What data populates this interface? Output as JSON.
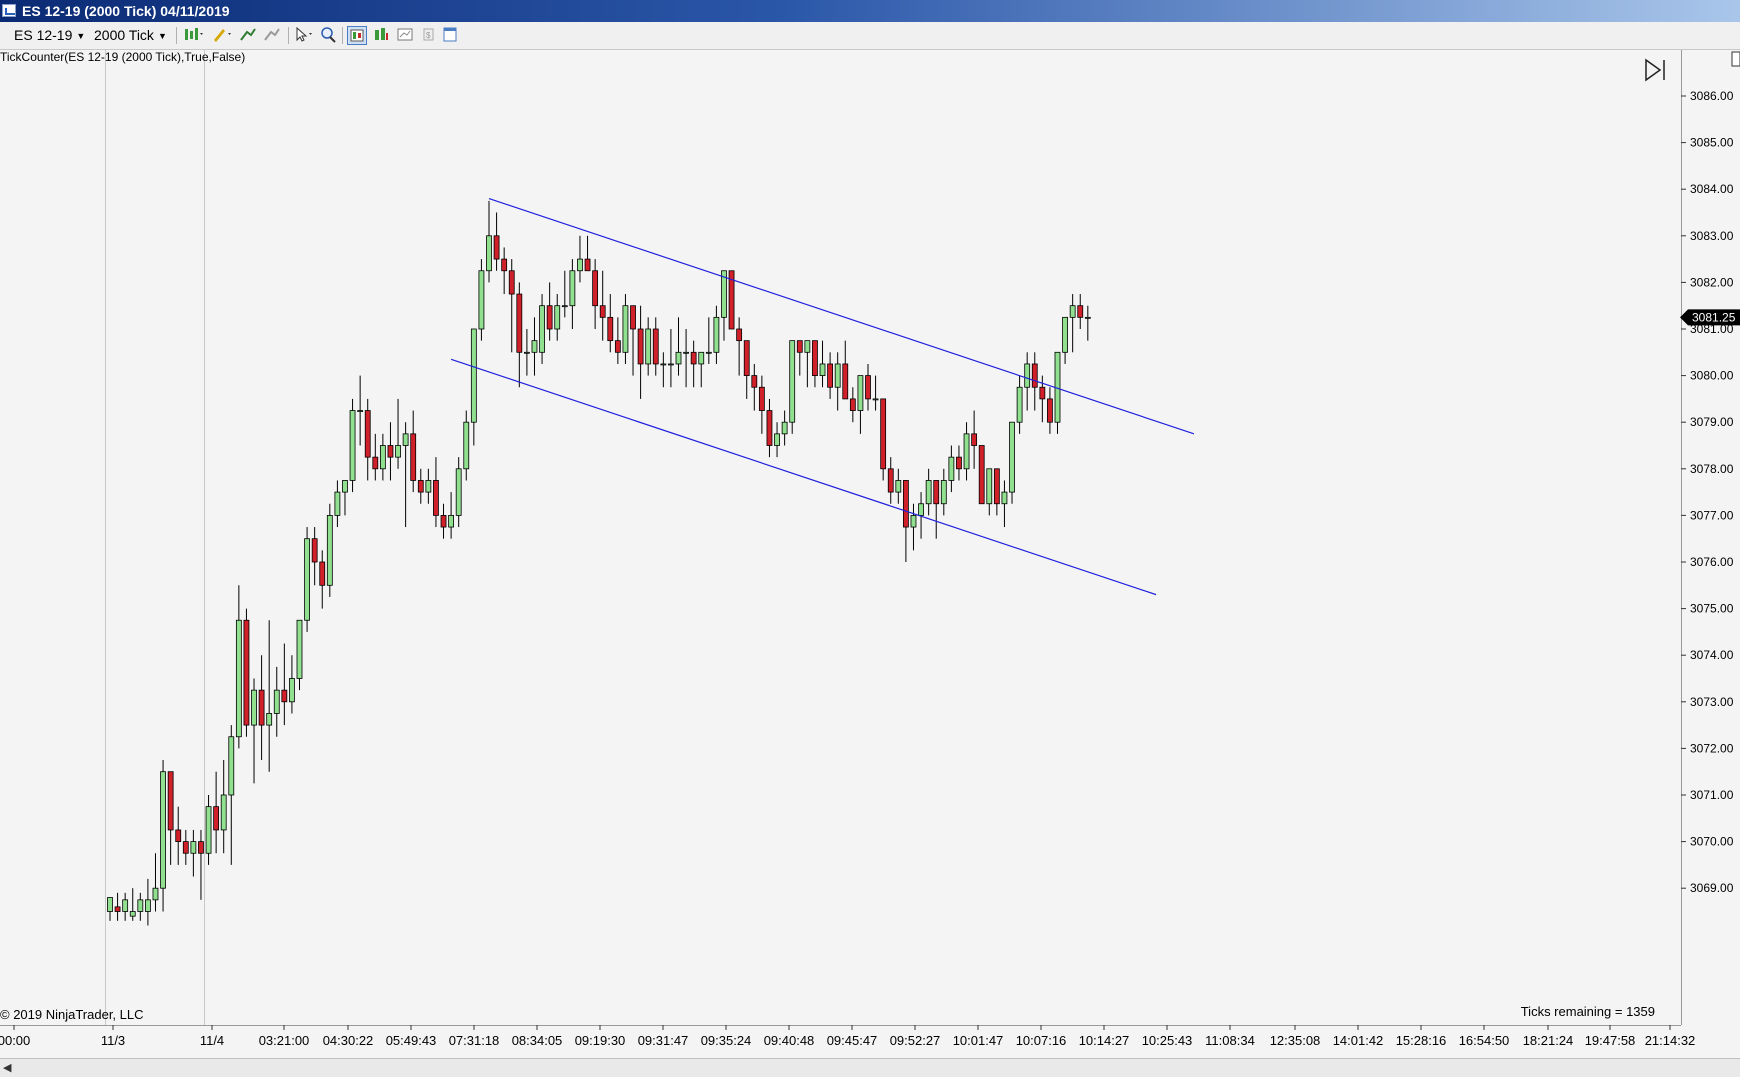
{
  "window": {
    "title": "ES 12-19 (2000 Tick)  04/11/2019"
  },
  "toolbar": {
    "instrument": "ES 12-19",
    "interval": "2000 Tick",
    "icons": [
      "bar-style-icon",
      "drawing-pencil-icon",
      "indicator-icon",
      "strategy-icon",
      "cursor-icon",
      "zoom-icon",
      "data-box-icon",
      "chart-trader-icon",
      "properties-icon",
      "template-icon",
      "window-icon"
    ]
  },
  "chart": {
    "indicator_label": "TickCounter(ES  12-19 (2000 Tick),True,False)",
    "copyright": "© 2019 NinjaTrader, LLC",
    "ticks_remaining": "Ticks remaining = 1359",
    "current_price_label": "3081.25",
    "colors": {
      "background": "#f4f4f4",
      "up_body": "#90e090",
      "down_body": "#d0202a",
      "wick": "#000000",
      "trendline": "#2020e0",
      "price_marker_bg": "#000000"
    }
  },
  "chart_data": {
    "type": "candlestick",
    "instrument": "ES 12-19",
    "interval": "2000 Tick",
    "y_axis": {
      "ticks": [
        "3069.00",
        "3070.00",
        "3071.00",
        "3072.00",
        "3073.00",
        "3074.00",
        "3075.00",
        "3076.00",
        "3077.00",
        "3078.00",
        "3079.00",
        "3080.00",
        "3081.00",
        "3082.00",
        "3083.00",
        "3084.00",
        "3085.00",
        "3086.00"
      ],
      "range": [
        3068.25,
        3086.9
      ]
    },
    "x_axis": {
      "ticks": [
        "00:00",
        "11/3",
        "11/4",
        "03:21:00",
        "04:30:22",
        "05:49:43",
        "07:31:18",
        "08:34:05",
        "09:19:30",
        "09:31:47",
        "09:35:24",
        "09:40:48",
        "09:45:47",
        "09:52:27",
        "10:01:47",
        "10:07:16",
        "10:14:27",
        "10:25:43",
        "11:08:34",
        "12:35:08",
        "14:01:42",
        "15:28:16",
        "16:54:50",
        "18:21:24",
        "19:47:58",
        "21:14:32"
      ]
    },
    "bars": [
      {
        "o": 3068.5,
        "h": 3068.8,
        "l": 3068.3,
        "c": 3068.8
      },
      {
        "o": 3068.6,
        "h": 3068.9,
        "l": 3068.3,
        "c": 3068.5
      },
      {
        "o": 3068.5,
        "h": 3068.9,
        "l": 3068.3,
        "c": 3068.75
      },
      {
        "o": 3068.4,
        "h": 3069.0,
        "l": 3068.3,
        "c": 3068.5
      },
      {
        "o": 3068.5,
        "h": 3068.9,
        "l": 3068.3,
        "c": 3068.75
      },
      {
        "o": 3068.5,
        "h": 3069.2,
        "l": 3068.2,
        "c": 3068.75
      },
      {
        "o": 3068.75,
        "h": 3069.75,
        "l": 3068.5,
        "c": 3069.0
      },
      {
        "o": 3069.0,
        "h": 3071.75,
        "l": 3068.5,
        "c": 3071.5
      },
      {
        "o": 3071.5,
        "h": 3071.5,
        "l": 3069.5,
        "c": 3070.25
      },
      {
        "o": 3070.25,
        "h": 3070.75,
        "l": 3069.5,
        "c": 3070.0
      },
      {
        "o": 3070.0,
        "h": 3070.25,
        "l": 3069.5,
        "c": 3069.75
      },
      {
        "o": 3069.75,
        "h": 3070.25,
        "l": 3069.25,
        "c": 3070.0
      },
      {
        "o": 3070.0,
        "h": 3070.25,
        "l": 3068.75,
        "c": 3069.75
      },
      {
        "o": 3069.75,
        "h": 3071.0,
        "l": 3069.5,
        "c": 3070.75
      },
      {
        "o": 3070.75,
        "h": 3071.5,
        "l": 3069.75,
        "c": 3070.25
      },
      {
        "o": 3070.25,
        "h": 3071.75,
        "l": 3069.75,
        "c": 3071.0
      },
      {
        "o": 3071.0,
        "h": 3072.5,
        "l": 3069.5,
        "c": 3072.25
      },
      {
        "o": 3072.25,
        "h": 3075.5,
        "l": 3072.0,
        "c": 3074.75
      },
      {
        "o": 3074.75,
        "h": 3075.0,
        "l": 3072.25,
        "c": 3072.5
      },
      {
        "o": 3072.5,
        "h": 3073.5,
        "l": 3071.25,
        "c": 3073.25
      },
      {
        "o": 3073.25,
        "h": 3074.0,
        "l": 3071.75,
        "c": 3072.5
      },
      {
        "o": 3072.5,
        "h": 3074.75,
        "l": 3071.5,
        "c": 3072.75
      },
      {
        "o": 3072.75,
        "h": 3073.75,
        "l": 3072.25,
        "c": 3073.25
      },
      {
        "o": 3073.25,
        "h": 3074.25,
        "l": 3072.5,
        "c": 3073.0
      },
      {
        "o": 3073.0,
        "h": 3074.0,
        "l": 3072.75,
        "c": 3073.5
      },
      {
        "o": 3073.5,
        "h": 3074.75,
        "l": 3073.25,
        "c": 3074.75
      },
      {
        "o": 3074.75,
        "h": 3076.75,
        "l": 3074.5,
        "c": 3076.5
      },
      {
        "o": 3076.5,
        "h": 3076.75,
        "l": 3075.5,
        "c": 3076.0
      },
      {
        "o": 3076.0,
        "h": 3076.25,
        "l": 3075.0,
        "c": 3075.5
      },
      {
        "o": 3075.5,
        "h": 3077.25,
        "l": 3075.25,
        "c": 3077.0
      },
      {
        "o": 3077.0,
        "h": 3077.75,
        "l": 3076.75,
        "c": 3077.5
      },
      {
        "o": 3077.5,
        "h": 3077.75,
        "l": 3077.0,
        "c": 3077.75
      },
      {
        "o": 3077.75,
        "h": 3079.5,
        "l": 3077.5,
        "c": 3079.25
      },
      {
        "o": 3079.25,
        "h": 3080.0,
        "l": 3078.5,
        "c": 3079.25
      },
      {
        "o": 3079.25,
        "h": 3079.5,
        "l": 3077.75,
        "c": 3078.25
      },
      {
        "o": 3078.25,
        "h": 3078.75,
        "l": 3077.75,
        "c": 3078.0
      },
      {
        "o": 3078.0,
        "h": 3078.75,
        "l": 3077.75,
        "c": 3078.5
      },
      {
        "o": 3078.5,
        "h": 3079.0,
        "l": 3077.75,
        "c": 3078.25
      },
      {
        "o": 3078.25,
        "h": 3079.5,
        "l": 3078.0,
        "c": 3078.5
      },
      {
        "o": 3078.5,
        "h": 3079.0,
        "l": 3076.75,
        "c": 3078.75
      },
      {
        "o": 3078.75,
        "h": 3079.25,
        "l": 3077.5,
        "c": 3077.75
      },
      {
        "o": 3077.75,
        "h": 3078.0,
        "l": 3077.25,
        "c": 3077.5
      },
      {
        "o": 3077.5,
        "h": 3078.0,
        "l": 3077.25,
        "c": 3077.75
      },
      {
        "o": 3077.75,
        "h": 3078.25,
        "l": 3076.75,
        "c": 3077.0
      },
      {
        "o": 3077.0,
        "h": 3077.25,
        "l": 3076.5,
        "c": 3076.75
      },
      {
        "o": 3076.75,
        "h": 3077.5,
        "l": 3076.5,
        "c": 3077.0
      },
      {
        "o": 3077.0,
        "h": 3078.25,
        "l": 3076.75,
        "c": 3078.0
      },
      {
        "o": 3078.0,
        "h": 3079.25,
        "l": 3077.75,
        "c": 3079.0
      },
      {
        "o": 3079.0,
        "h": 3081.0,
        "l": 3078.5,
        "c": 3081.0
      },
      {
        "o": 3081.0,
        "h": 3082.5,
        "l": 3080.75,
        "c": 3082.25
      },
      {
        "o": 3082.25,
        "h": 3083.75,
        "l": 3082.0,
        "c": 3083.0
      },
      {
        "o": 3083.0,
        "h": 3083.5,
        "l": 3082.25,
        "c": 3082.5
      },
      {
        "o": 3082.5,
        "h": 3082.75,
        "l": 3081.75,
        "c": 3082.25
      },
      {
        "o": 3082.25,
        "h": 3082.5,
        "l": 3080.5,
        "c": 3081.75
      },
      {
        "o": 3081.75,
        "h": 3082.0,
        "l": 3079.75,
        "c": 3080.5
      },
      {
        "o": 3080.5,
        "h": 3081.0,
        "l": 3080.0,
        "c": 3080.5
      },
      {
        "o": 3080.5,
        "h": 3081.25,
        "l": 3080.0,
        "c": 3080.75
      },
      {
        "o": 3080.5,
        "h": 3081.75,
        "l": 3080.25,
        "c": 3081.5
      },
      {
        "o": 3081.5,
        "h": 3082.0,
        "l": 3080.75,
        "c": 3081.0
      },
      {
        "o": 3081.0,
        "h": 3081.75,
        "l": 3080.75,
        "c": 3081.5
      },
      {
        "o": 3081.5,
        "h": 3082.25,
        "l": 3081.25,
        "c": 3081.5
      },
      {
        "o": 3081.5,
        "h": 3082.5,
        "l": 3081.0,
        "c": 3082.25
      },
      {
        "o": 3082.25,
        "h": 3083.0,
        "l": 3082.0,
        "c": 3082.5
      },
      {
        "o": 3082.5,
        "h": 3083.0,
        "l": 3082.25,
        "c": 3082.25
      },
      {
        "o": 3082.25,
        "h": 3082.5,
        "l": 3081.0,
        "c": 3081.5
      },
      {
        "o": 3081.5,
        "h": 3082.25,
        "l": 3080.75,
        "c": 3081.25
      },
      {
        "o": 3081.25,
        "h": 3081.75,
        "l": 3080.5,
        "c": 3080.75
      },
      {
        "o": 3080.75,
        "h": 3081.25,
        "l": 3080.25,
        "c": 3080.5
      },
      {
        "o": 3080.5,
        "h": 3081.75,
        "l": 3080.25,
        "c": 3081.5
      },
      {
        "o": 3081.5,
        "h": 3081.5,
        "l": 3080.0,
        "c": 3081.0
      },
      {
        "o": 3081.0,
        "h": 3081.5,
        "l": 3079.5,
        "c": 3080.25
      },
      {
        "o": 3080.25,
        "h": 3081.25,
        "l": 3080.0,
        "c": 3081.0
      },
      {
        "o": 3081.0,
        "h": 3081.25,
        "l": 3080.0,
        "c": 3080.25
      },
      {
        "o": 3080.25,
        "h": 3080.5,
        "l": 3079.75,
        "c": 3080.25
      },
      {
        "o": 3080.25,
        "h": 3081.0,
        "l": 3079.75,
        "c": 3080.25
      },
      {
        "o": 3080.25,
        "h": 3081.25,
        "l": 3080.0,
        "c": 3080.5
      },
      {
        "o": 3080.5,
        "h": 3081.0,
        "l": 3079.75,
        "c": 3080.5
      },
      {
        "o": 3080.5,
        "h": 3080.75,
        "l": 3079.75,
        "c": 3080.25
      },
      {
        "o": 3080.25,
        "h": 3080.5,
        "l": 3079.75,
        "c": 3080.5
      },
      {
        "o": 3080.5,
        "h": 3081.25,
        "l": 3080.25,
        "c": 3080.5
      },
      {
        "o": 3080.5,
        "h": 3081.5,
        "l": 3080.25,
        "c": 3081.25
      },
      {
        "o": 3081.25,
        "h": 3082.25,
        "l": 3080.75,
        "c": 3082.25
      },
      {
        "o": 3082.25,
        "h": 3082.25,
        "l": 3081.5,
        "c": 3081.0
      },
      {
        "o": 3081.0,
        "h": 3081.25,
        "l": 3080.0,
        "c": 3080.75
      },
      {
        "o": 3080.75,
        "h": 3080.75,
        "l": 3079.5,
        "c": 3080.0
      },
      {
        "o": 3080.0,
        "h": 3080.25,
        "l": 3079.25,
        "c": 3079.75
      },
      {
        "o": 3079.75,
        "h": 3080.0,
        "l": 3078.75,
        "c": 3079.25
      },
      {
        "o": 3079.25,
        "h": 3079.5,
        "l": 3078.25,
        "c": 3078.5
      },
      {
        "o": 3078.5,
        "h": 3079.0,
        "l": 3078.25,
        "c": 3078.75
      },
      {
        "o": 3078.75,
        "h": 3079.25,
        "l": 3078.5,
        "c": 3079.0
      },
      {
        "o": 3079.0,
        "h": 3080.75,
        "l": 3078.75,
        "c": 3080.75
      },
      {
        "o": 3080.75,
        "h": 3080.75,
        "l": 3080.0,
        "c": 3080.5
      },
      {
        "o": 3080.5,
        "h": 3080.75,
        "l": 3079.75,
        "c": 3080.75
      },
      {
        "o": 3080.75,
        "h": 3080.75,
        "l": 3079.75,
        "c": 3080.0
      },
      {
        "o": 3080.0,
        "h": 3080.75,
        "l": 3079.75,
        "c": 3080.25
      },
      {
        "o": 3080.25,
        "h": 3080.5,
        "l": 3079.5,
        "c": 3079.75
      },
      {
        "o": 3079.75,
        "h": 3080.5,
        "l": 3079.25,
        "c": 3080.25
      },
      {
        "o": 3080.25,
        "h": 3080.75,
        "l": 3079.5,
        "c": 3079.5
      },
      {
        "o": 3079.5,
        "h": 3079.75,
        "l": 3079.0,
        "c": 3079.25
      },
      {
        "o": 3079.25,
        "h": 3080.0,
        "l": 3078.75,
        "c": 3080.0
      },
      {
        "o": 3080.0,
        "h": 3080.25,
        "l": 3079.25,
        "c": 3079.5
      },
      {
        "o": 3079.5,
        "h": 3080.0,
        "l": 3079.25,
        "c": 3079.5
      },
      {
        "o": 3079.5,
        "h": 3079.5,
        "l": 3077.75,
        "c": 3078.0
      },
      {
        "o": 3078.0,
        "h": 3078.25,
        "l": 3077.25,
        "c": 3077.5
      },
      {
        "o": 3077.5,
        "h": 3078.0,
        "l": 3077.25,
        "c": 3077.75
      },
      {
        "o": 3077.75,
        "h": 3077.75,
        "l": 3076.0,
        "c": 3076.75
      },
      {
        "o": 3076.75,
        "h": 3077.25,
        "l": 3076.25,
        "c": 3077.0
      },
      {
        "o": 3077.0,
        "h": 3077.5,
        "l": 3076.5,
        "c": 3077.25
      },
      {
        "o": 3077.25,
        "h": 3078.0,
        "l": 3077.0,
        "c": 3077.75
      },
      {
        "o": 3077.75,
        "h": 3077.75,
        "l": 3076.5,
        "c": 3077.25
      },
      {
        "o": 3077.25,
        "h": 3078.0,
        "l": 3077.0,
        "c": 3077.75
      },
      {
        "o": 3077.75,
        "h": 3078.5,
        "l": 3077.5,
        "c": 3078.25
      },
      {
        "o": 3078.25,
        "h": 3078.5,
        "l": 3077.75,
        "c": 3078.0
      },
      {
        "o": 3078.0,
        "h": 3079.0,
        "l": 3077.75,
        "c": 3078.75
      },
      {
        "o": 3078.75,
        "h": 3079.25,
        "l": 3078.0,
        "c": 3078.5
      },
      {
        "o": 3078.5,
        "h": 3078.5,
        "l": 3077.25,
        "c": 3077.25
      },
      {
        "o": 3077.25,
        "h": 3078.0,
        "l": 3077.0,
        "c": 3078.0
      },
      {
        "o": 3078.0,
        "h": 3078.0,
        "l": 3077.0,
        "c": 3077.25
      },
      {
        "o": 3077.25,
        "h": 3077.75,
        "l": 3076.75,
        "c": 3077.5
      },
      {
        "o": 3077.5,
        "h": 3079.0,
        "l": 3077.25,
        "c": 3079.0
      },
      {
        "o": 3079.0,
        "h": 3080.0,
        "l": 3078.75,
        "c": 3079.75
      },
      {
        "o": 3079.75,
        "h": 3080.5,
        "l": 3079.25,
        "c": 3080.25
      },
      {
        "o": 3080.25,
        "h": 3080.5,
        "l": 3079.25,
        "c": 3079.75
      },
      {
        "o": 3079.75,
        "h": 3080.0,
        "l": 3079.0,
        "c": 3079.5
      },
      {
        "o": 3079.5,
        "h": 3079.75,
        "l": 3078.75,
        "c": 3079.0
      },
      {
        "o": 3079.0,
        "h": 3080.5,
        "l": 3078.75,
        "c": 3080.5
      },
      {
        "o": 3080.5,
        "h": 3081.25,
        "l": 3080.25,
        "c": 3081.25
      },
      {
        "o": 3081.25,
        "h": 3081.75,
        "l": 3080.5,
        "c": 3081.5
      },
      {
        "o": 3081.5,
        "h": 3081.75,
        "l": 3081.0,
        "c": 3081.25
      },
      {
        "o": 3081.25,
        "h": 3081.5,
        "l": 3080.75,
        "c": 3081.25
      }
    ],
    "trendlines": [
      {
        "from_bar": 50,
        "from_price": 3083.8,
        "to_bar": 143,
        "to_price": 3078.75
      },
      {
        "from_bar": 45,
        "from_price": 3080.35,
        "to_bar": 138,
        "to_price": 3075.3
      }
    ]
  }
}
